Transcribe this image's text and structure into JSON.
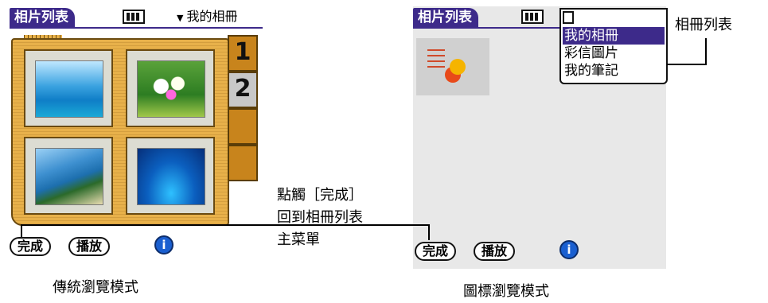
{
  "left_screen": {
    "title": "相片列表",
    "album_name": "我的相冊",
    "pages": [
      "1",
      "2"
    ],
    "done_label": "完成",
    "play_label": "播放",
    "info_label": "i"
  },
  "right_screen": {
    "title": "相片列表",
    "albums": [
      "我的相冊",
      "彩信圖片",
      "我的筆記"
    ],
    "done_label": "完成",
    "play_label": "播放",
    "info_label": "i"
  },
  "annotations": {
    "album_list": "相冊列表",
    "tap_done_lines": [
      "點觸［完成］",
      "回到相冊列表",
      "主菜單"
    ],
    "left_caption": "傳統瀏覽模式",
    "right_caption": "圖標瀏覽模式"
  },
  "colors": {
    "title_bar": "#3d2a8a",
    "album_frame": "#e8b14a",
    "info_button": "#1a5fd0"
  }
}
